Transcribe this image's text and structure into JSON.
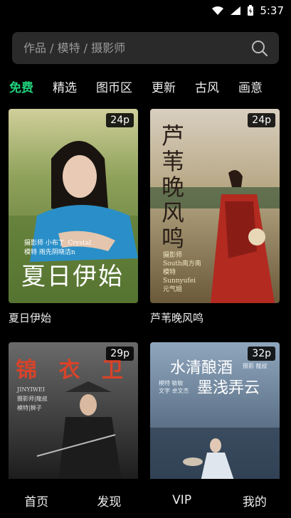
{
  "status": {
    "time": "5:37"
  },
  "search": {
    "placeholder": "作品 / 模特 / 摄影师"
  },
  "tabs": [
    {
      "label": "免费"
    },
    {
      "label": "精选"
    },
    {
      "label": "图币区"
    },
    {
      "label": "更新"
    },
    {
      "label": "古风"
    },
    {
      "label": "画意"
    }
  ],
  "cards": [
    {
      "title": "夏日伊始",
      "count": "24p",
      "overlay_lines": [
        "摄影师 小布丁_Crystal",
        "模特 雨先阴晓洁n"
      ],
      "overlay_title": "夏日伊始"
    },
    {
      "title": "芦苇晚风鸣",
      "count": "24p",
      "overlay_title": "芦苇晚风鸣",
      "overlay_lines": [
        "摄影师",
        "South南方南",
        "模特",
        "Sunnyufei",
        "元气姐"
      ]
    },
    {
      "title": "",
      "count": "29p",
      "overlay_title": "锦 衣 卫",
      "overlay_lines": [
        "JINYIWEI",
        "摄影师|龍叔",
        "模特|狮子"
      ]
    },
    {
      "title": "",
      "count": "32p",
      "overlay_title": "水清酿酒",
      "overlay_title2": "墨浅弄云",
      "overlay_lines": [
        "摄影 龍叔",
        "模特 敏敏",
        "文字 卓文杰"
      ]
    }
  ],
  "bottom_nav": [
    {
      "label": "首页"
    },
    {
      "label": "发现"
    },
    {
      "label": "VIP"
    },
    {
      "label": "我的"
    }
  ],
  "colors": {
    "accent": "#1fd07a",
    "background": "#000000",
    "search_bg": "#2a2a2a"
  }
}
